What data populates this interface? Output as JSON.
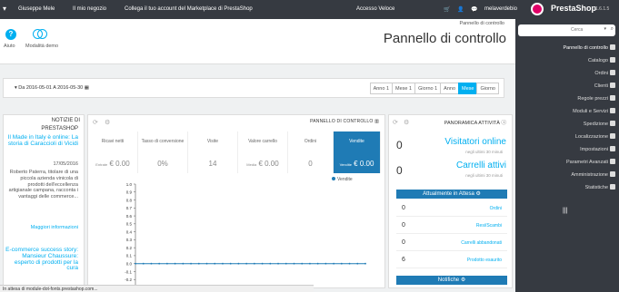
{
  "topbar": {
    "user": "Giuseppe Mele",
    "shop": "Il mio negozio",
    "marketplace": "Collega il tuo account del Marketplace di PrestaShop",
    "quick_access": "Accesso Veloce",
    "domain": "melaverdebio",
    "brand": "PrestaShop",
    "version": "1.6.1.5"
  },
  "sidebar": {
    "search_placeholder": "Cerca",
    "items": [
      {
        "label": "Pannello di controllo",
        "icon": "dashboard-icon"
      },
      {
        "label": "Catalogo",
        "icon": "catalog-icon"
      },
      {
        "label": "Ordini",
        "icon": "orders-icon"
      },
      {
        "label": "Clienti",
        "icon": "customers-icon"
      },
      {
        "label": "Regole prezzi",
        "icon": "price-rules-icon"
      },
      {
        "label": "Moduli e Servizi",
        "icon": "modules-icon"
      },
      {
        "label": "Spedizione",
        "icon": "shipping-icon"
      },
      {
        "label": "Localizzazione",
        "icon": "localization-icon"
      },
      {
        "label": "Impostazioni",
        "icon": "settings-icon"
      },
      {
        "label": "Parametri Avanzati",
        "icon": "advanced-params-icon"
      },
      {
        "label": "Amministrazione",
        "icon": "admin-icon"
      },
      {
        "label": "Statistiche",
        "icon": "stats-icon"
      }
    ]
  },
  "header": {
    "help": "Aiuto",
    "demo": "Modalità demo",
    "breadcrumb": "Pannello di controllo",
    "title": "Pannello di controllo"
  },
  "date_bar": {
    "range": "Da 2016-05-01 A 2016-05-30",
    "periods": [
      "Anno 1",
      "Mese 1",
      "Giorno 1",
      "Anno",
      "Mese",
      "Giorno"
    ],
    "selected": "Mese"
  },
  "news": {
    "head1": "NOTIZIE DI",
    "head2": "PRESTASHOP",
    "item1_title": "Il Made in Italy è online: La storia di Caraccioli di Vicidi",
    "item1_date": "17/05/2016",
    "item1_body": "Roberto Paterra, titolare di una piccola azienda vinicola di prodotti dell'eccellenza artigianale campana, racconta i vantaggi delle commerce...",
    "item1_more": "Maggiori informazioni",
    "item2_title": "E-commerce success story: Mansieur Chaussure: esperto di prodotti per la cura"
  },
  "dashboard": {
    "title": "PANNELLO DI CONTROLLO",
    "kpis": [
      {
        "label": "Ricavi netti",
        "value": "€ 0.00",
        "prefix": "Entrate"
      },
      {
        "label": "Tasso di conversione",
        "value": "0%",
        "prefix": ""
      },
      {
        "label": "Visite",
        "value": "14",
        "prefix": ""
      },
      {
        "label": "Valore carrello",
        "value": "€ 0.00",
        "prefix": "Media"
      },
      {
        "label": "Ordini",
        "value": "0",
        "prefix": ""
      },
      {
        "label": "Vendite",
        "value": "€ 0.00",
        "prefix": "Vendite"
      }
    ],
    "legend": "Vendite"
  },
  "chart_data": {
    "type": "line",
    "series": [
      {
        "name": "Vendite",
        "values": [
          0,
          0,
          0,
          0,
          0,
          0,
          0,
          0,
          0,
          0,
          0,
          0,
          0,
          0,
          0,
          0,
          0,
          0,
          0,
          0,
          0,
          0,
          0,
          0,
          0,
          0,
          0,
          0,
          0,
          0
        ]
      }
    ],
    "yticks": [
      "1.0",
      "0.9",
      "0.8",
      "0.7",
      "0.6",
      "0.5",
      "0.4",
      "0.3",
      "0.2",
      "0.1",
      "0.0",
      "-0.1",
      "-0.2",
      "-0.3"
    ],
    "ylim": [
      -0.3,
      1.0
    ]
  },
  "activity": {
    "title": "PANORAMICA ATTIVITÀ",
    "visitors_count": "0",
    "visitors_label": "Visitatori online",
    "visitors_sub": "negli ultimi 30 minuti",
    "carts_count": "0",
    "carts_label": "Carrelli attivi",
    "carts_sub": "negli ultimi 30 minuti",
    "pending_title": "Attualmente in Attesa",
    "pending": [
      {
        "count": "0",
        "label": "Ordini"
      },
      {
        "count": "0",
        "label": "Resi/Scambi"
      },
      {
        "count": "0",
        "label": "Carrelli abbandonati"
      },
      {
        "count": "6",
        "label": "Prodotto esaurito"
      }
    ],
    "notifications": "Notifiche"
  },
  "statusbar": "In attesa di module-dot-fonts.prestashop.com..."
}
